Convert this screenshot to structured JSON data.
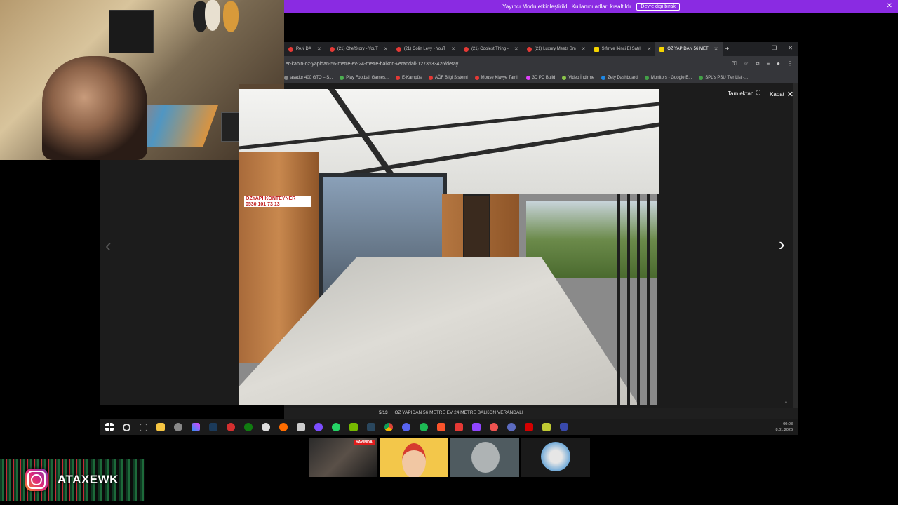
{
  "banner": {
    "text": "Yayıncı Modu etkinleştirildi. Kullanıcı adları kısaltıldı.",
    "button": "Devre dışı bırak",
    "close": "✕"
  },
  "tabs": [
    {
      "label": "PAN DA",
      "close": "✕",
      "icon": "youtube-icon"
    },
    {
      "label": "(21) ChefStory - YouT",
      "close": "✕",
      "icon": "youtube-icon"
    },
    {
      "label": "(21) Colin Levy - YouT",
      "close": "✕",
      "icon": "youtube-icon"
    },
    {
      "label": "(21) Coolest Thing -",
      "close": "✕",
      "icon": "youtube-icon"
    },
    {
      "label": "(21) Luxury Meets Sm",
      "close": "✕",
      "icon": "youtube-icon"
    },
    {
      "label": "Sıfır ve İkinci El Satılı",
      "close": "✕",
      "icon": "sahibinden-icon"
    },
    {
      "label": "ÖZ YAPIDAN 56 MET",
      "close": "✕",
      "icon": "sahibinden-icon"
    }
  ],
  "new_tab": "+",
  "window_controls": {
    "minimize": "─",
    "restore": "❐",
    "close": "✕"
  },
  "address": "er-kabin-oz-yapidan-56-metre-ev-24-metre-balkon-verandali-1273633426/detay",
  "bookmarks": [
    {
      "label": "asador 400 GTO – S...",
      "color": "#888888"
    },
    {
      "label": "Play Football Games...",
      "color": "#4caf50"
    },
    {
      "label": "E-Kampüs",
      "color": "#e53935"
    },
    {
      "label": "AÖF Bilgi Sistemi",
      "color": "#e53935"
    },
    {
      "label": "Mouse Klavye Tamir",
      "color": "#e53935"
    },
    {
      "label": "3D PC Build",
      "color": "#e040fb"
    },
    {
      "label": "Video İndirme",
      "color": "#8bc34a"
    },
    {
      "label": "Zety Dashboard",
      "color": "#1e88e5"
    },
    {
      "label": "Monitors - Google E...",
      "color": "#43a047"
    },
    {
      "label": "SPL's PSU Tier List -...",
      "color": "#43a047"
    }
  ],
  "viewer": {
    "fullscreen_label": "Tam ekran",
    "close_label": "Kapat",
    "counter": "5/13",
    "caption": "ÖZ YAPIDAN 56 METRE EV 24 METRE BALKON VERANDALI",
    "prev": "‹",
    "next": "›"
  },
  "photo_sign": {
    "line1": "ÖZYAPI KONTEYNER",
    "line2": "0530 101 73 13"
  },
  "clock": {
    "time": "00:03",
    "date": "8.01.2026"
  },
  "thumbnails": {
    "live_badge": "YAYINDA"
  },
  "instagram": {
    "handle": "ATAXEWK"
  }
}
